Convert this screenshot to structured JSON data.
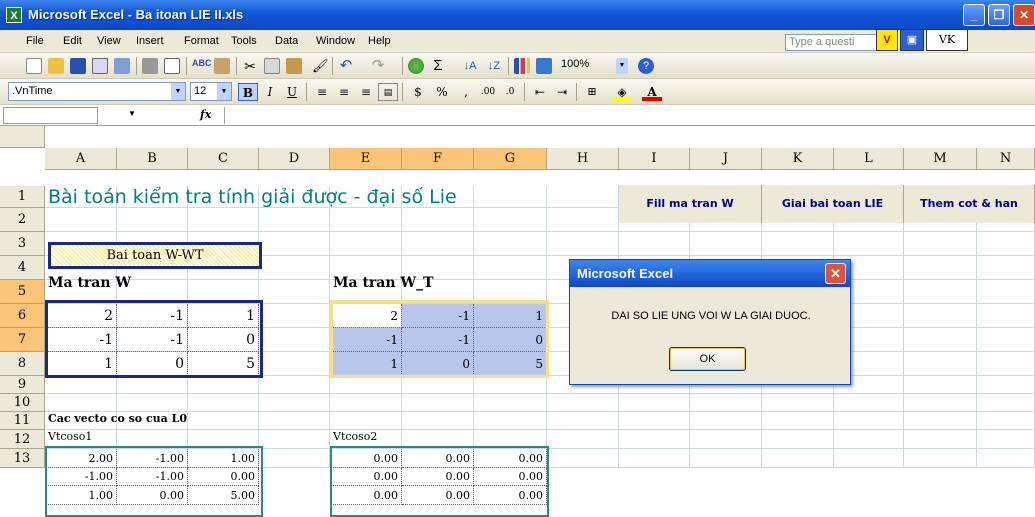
{
  "window": {
    "title": "Microsoft Excel - Ba itoan LIE II.xls",
    "app_icon": "X"
  },
  "menu": [
    "File",
    "Edit",
    "View",
    "Insert",
    "Format",
    "Tools",
    "Data",
    "Window",
    "Help"
  ],
  "help_placeholder": "Type a questi",
  "vk_labels": {
    "v": "V",
    "vk": "VK"
  },
  "standard_toolbar": {
    "zoom": "100%"
  },
  "format_toolbar": {
    "font": ".VnTime",
    "size": "12",
    "bold": "B",
    "italic": "I",
    "underline": "U",
    "currency": "$",
    "percent": "%",
    "comma": ","
  },
  "formula_bar": {
    "fx": "fx"
  },
  "columns": [
    "A",
    "B",
    "C",
    "D",
    "E",
    "F",
    "G",
    "H",
    "I",
    "J",
    "K",
    "L",
    "M",
    "N"
  ],
  "rows": [
    "1",
    "2",
    "3",
    "4",
    "5",
    "6",
    "7",
    "8",
    "9",
    "10",
    "11",
    "12",
    "13"
  ],
  "sheet": {
    "title": "Bài toán kiểm tra tính giải được - đại số Lie",
    "problem_label": "Bai toan W-WT",
    "matrix_w_label": "Ma tran W",
    "matrix_wt_label": "Ma tran W_T",
    "matrix_w": [
      [
        "2",
        "-1",
        "1"
      ],
      [
        "-1",
        "-1",
        "0"
      ],
      [
        "1",
        "0",
        "5"
      ]
    ],
    "matrix_wt": [
      [
        "2",
        "-1",
        "1"
      ],
      [
        "-1",
        "-1",
        "0"
      ],
      [
        "1",
        "0",
        "5"
      ]
    ],
    "basis_label": "Cac vecto co so cua L0",
    "vector1_label": "Vtcoso1",
    "vector2_label": "Vtcoso2",
    "vector1": [
      [
        "2.00",
        "-1.00",
        "1.00"
      ],
      [
        "-1.00",
        "-1.00",
        "0.00"
      ],
      [
        "1.00",
        "0.00",
        "5.00"
      ]
    ],
    "vector2": [
      [
        "0.00",
        "0.00",
        "0.00"
      ],
      [
        "0.00",
        "0.00",
        "0.00"
      ],
      [
        "0.00",
        "0.00",
        "0.00"
      ]
    ]
  },
  "sheet_buttons": {
    "fill": "Fill ma tran W",
    "solve": "Giai bai toan LIE",
    "add": "Them cot & han"
  },
  "dialog": {
    "title": "Microsoft Excel",
    "message": "DAI SO LIE UNG VOI W LA GIAI DUOC.",
    "ok": "OK"
  }
}
